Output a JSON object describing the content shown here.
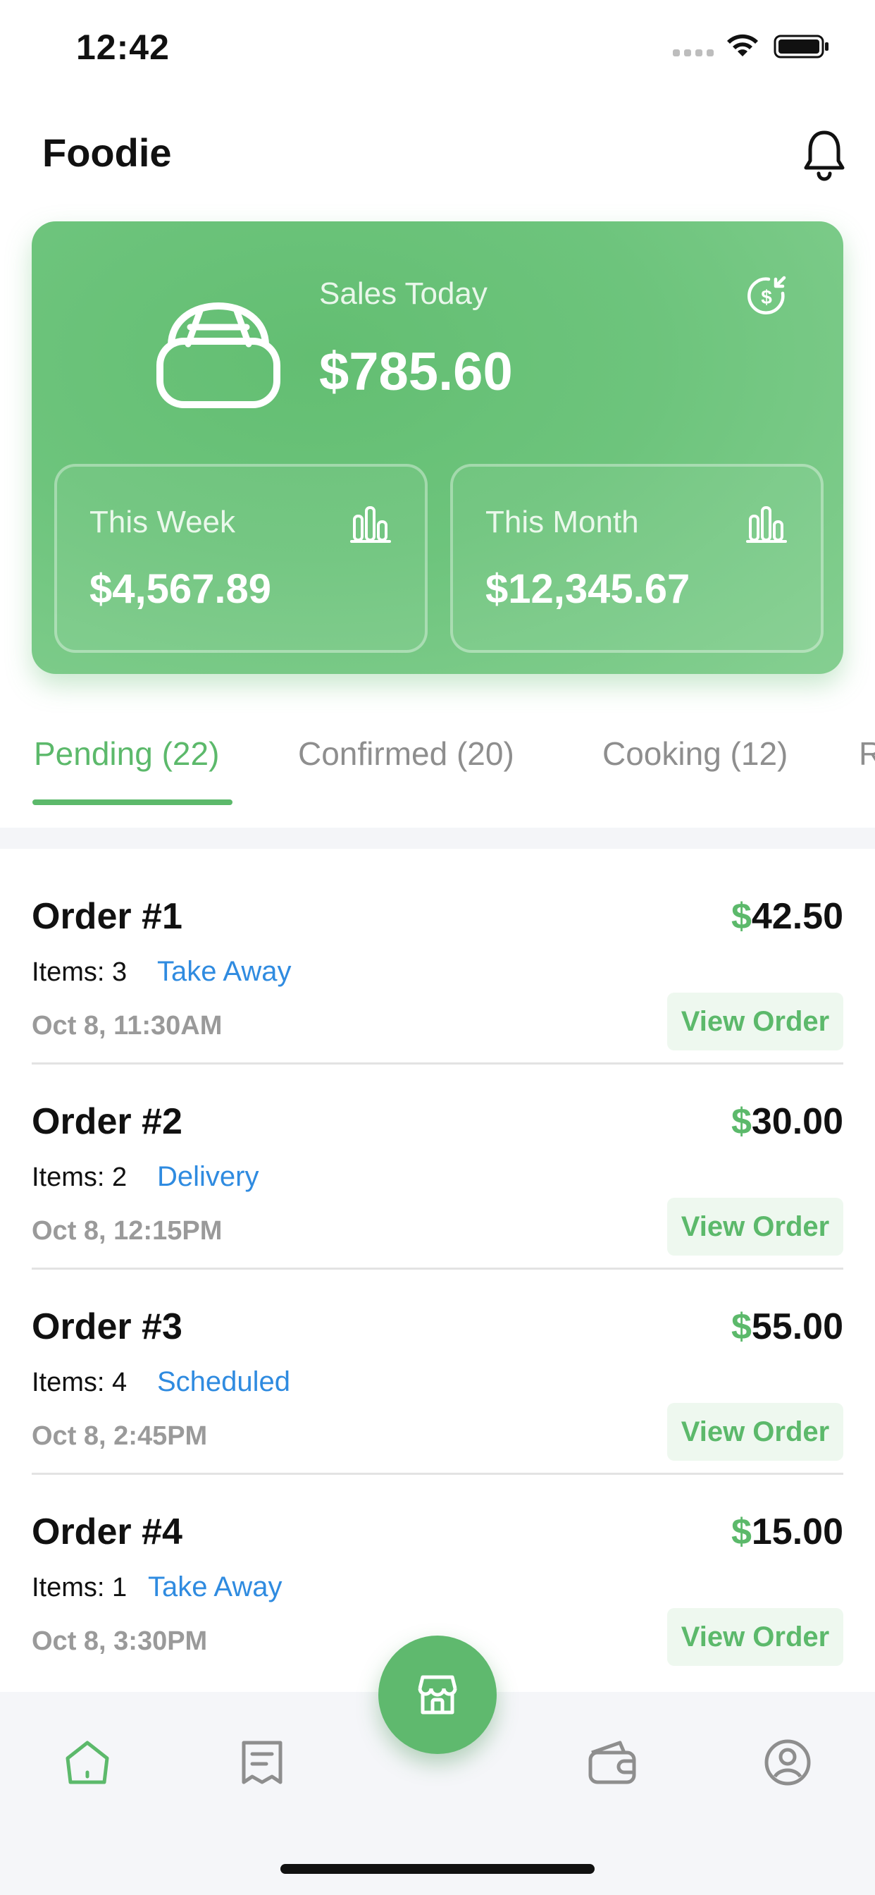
{
  "status_bar": {
    "time": "12:42"
  },
  "header": {
    "title": "Foodie",
    "notification_icon": "bell-icon"
  },
  "sales_card": {
    "label": "Sales Today",
    "value": "$785.60",
    "icon": "basket-icon",
    "refresh_icon": "currency-refresh-icon",
    "week": {
      "label": "This Week",
      "value": "$4,567.89",
      "icon": "bar-chart-icon"
    },
    "month": {
      "label": "This Month",
      "value": "$12,345.67",
      "icon": "bar-chart-icon"
    }
  },
  "tabs": [
    {
      "label": "Pending (22)",
      "active": true
    },
    {
      "label": "Confirmed (20)",
      "active": false
    },
    {
      "label": "Cooking (12)",
      "active": false
    },
    {
      "label": "R",
      "active": false
    }
  ],
  "orders": [
    {
      "title": "Order #1",
      "currency": "$",
      "amount": "42.50",
      "items": "Items: 3",
      "type": "Take Away",
      "date": "Oct 8, 11:30AM",
      "action": "View Order"
    },
    {
      "title": "Order #2",
      "currency": "$",
      "amount": "30.00",
      "items": "Items: 2",
      "type": "Delivery",
      "date": "Oct 8, 12:15PM",
      "action": "View Order"
    },
    {
      "title": "Order #3",
      "currency": "$",
      "amount": "55.00",
      "items": "Items: 4",
      "type": "Scheduled",
      "date": "Oct 8, 2:45PM",
      "action": "View Order"
    },
    {
      "title": "Order #4",
      "currency": "$",
      "amount": "15.00",
      "items": "Items: 1",
      "type": "Take Away",
      "date": "Oct 8, 3:30PM",
      "action": "View Order"
    }
  ],
  "bottom_nav": [
    {
      "icon": "home-icon",
      "active": true
    },
    {
      "icon": "receipt-icon",
      "active": false
    },
    {
      "icon": "store-icon",
      "active": false
    },
    {
      "icon": "wallet-icon",
      "active": false
    },
    {
      "icon": "profile-icon",
      "active": false
    }
  ],
  "colors": {
    "accent": "#5cb96b",
    "link": "#2f8be0",
    "muted": "#9a9a9a"
  }
}
